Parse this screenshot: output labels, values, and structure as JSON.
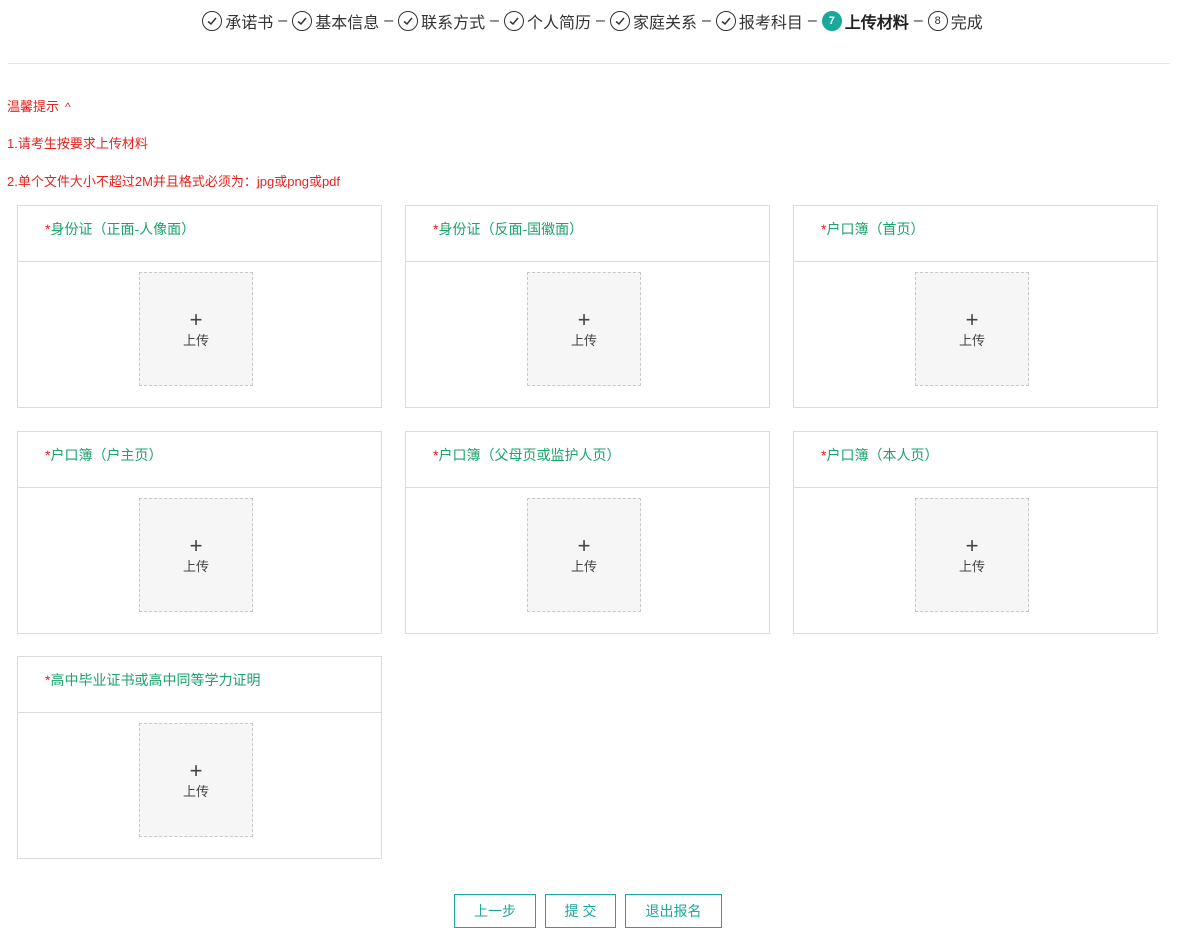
{
  "steps": [
    {
      "label": "承诺书",
      "status": "done"
    },
    {
      "label": "基本信息",
      "status": "done"
    },
    {
      "label": "联系方式",
      "status": "done"
    },
    {
      "label": "个人简历",
      "status": "done"
    },
    {
      "label": "家庭关系",
      "status": "done"
    },
    {
      "label": "报考科目",
      "status": "done"
    },
    {
      "label": "上传材料",
      "status": "active",
      "number": "7"
    },
    {
      "label": "完成",
      "status": "pending",
      "number": "8"
    }
  ],
  "step_separator": "–",
  "notice": {
    "title": "温馨提示",
    "caret": "^",
    "line1": "1.请考生按要求上传材料",
    "line2": "2.单个文件大小不超过2M并且格式必须为：jpg或png或pdf"
  },
  "required_mark": "*",
  "upload_label": "上传",
  "upload_plus": "+",
  "cards": [
    {
      "title": "身份证（正面-人像面）"
    },
    {
      "title": "身份证（反面-国徽面）"
    },
    {
      "title": "户口簿（首页）"
    },
    {
      "title": "户口簿（户主页）"
    },
    {
      "title": "户口簿（父母页或监护人页）"
    },
    {
      "title": "户口簿（本人页）"
    },
    {
      "title": "高中毕业证书或高中同等学力证明"
    }
  ],
  "buttons": {
    "prev": "上一步",
    "submit": "提 交",
    "exit": "退出报名"
  },
  "colors": {
    "accent": "#1aa89a",
    "title_green": "#1aa36a",
    "notice_red": "#e8211e"
  }
}
